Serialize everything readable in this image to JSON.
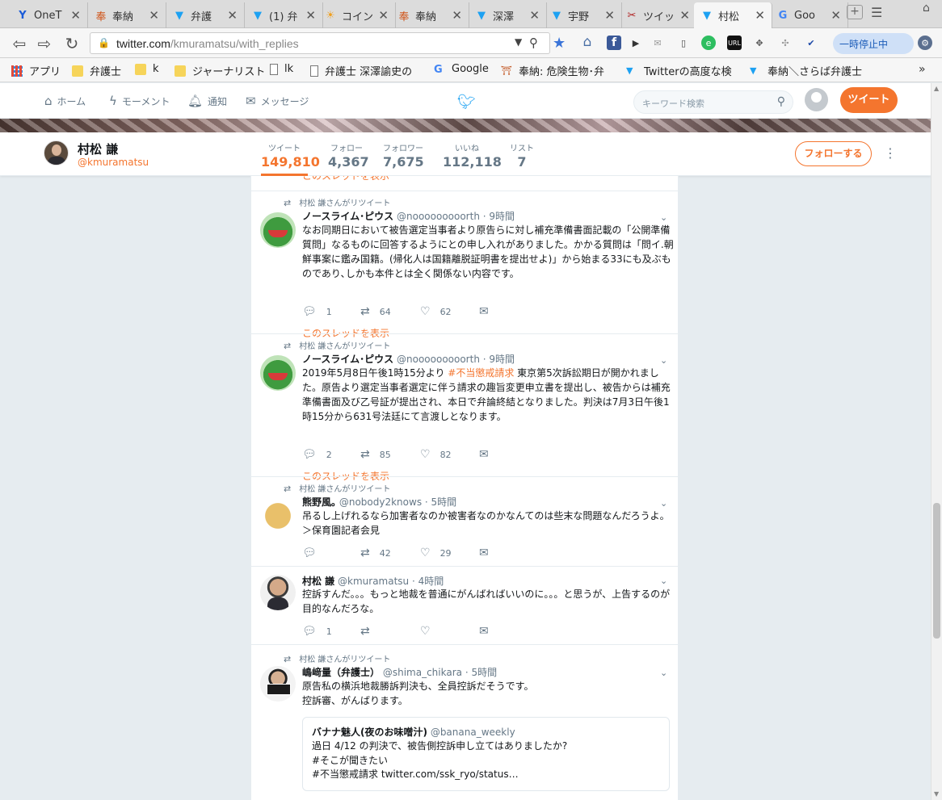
{
  "browser": {
    "tabs": [
      {
        "icon": "Y",
        "label": "OneT"
      },
      {
        "icon": "奉",
        "label": "奉納"
      },
      {
        "icon": "🐦",
        "label": "弁護"
      },
      {
        "icon": "🐦",
        "label": "(1) 弁"
      },
      {
        "icon": "☀",
        "label": "コイン"
      },
      {
        "icon": "奉",
        "label": "奉納"
      },
      {
        "icon": "🐦",
        "label": "深澤"
      },
      {
        "icon": "🐦",
        "label": "宇野"
      },
      {
        "icon": "✂",
        "label": "ツイッ"
      },
      {
        "icon": "🐦",
        "label": "村松"
      },
      {
        "icon": "G",
        "label": "Goo"
      }
    ],
    "url_host": "twitter.com",
    "url_path": "/kmuramatsu/with_replies",
    "pause_label": "一時停止中",
    "bookmarks": [
      "アプリ",
      "弁護士",
      "k",
      "ジャーナリスト",
      "lk",
      "弁護士 深澤諭史の",
      "Google",
      "奉納: 危険生物･弁",
      "Twitterの高度な検",
      "奉納＼さらば弁護士"
    ]
  },
  "twitter_nav": {
    "home": "ホーム",
    "moments": "モーメント",
    "notifications": "通知",
    "messages": "メッセージ",
    "search_placeholder": "キーワード検索",
    "tweet_button": "ツイート"
  },
  "profile": {
    "name": "村松 謙",
    "handle": "@kmuramatsu",
    "stats": [
      {
        "label": "ツイート",
        "value": "149,810"
      },
      {
        "label": "フォロー",
        "value": "4,367"
      },
      {
        "label": "フォロワー",
        "value": "7,675"
      },
      {
        "label": "いいね",
        "value": "112,118"
      },
      {
        "label": "リスト",
        "value": "7"
      }
    ],
    "follow_button": "フォローする"
  },
  "timeline": {
    "thread_link_top": "このスレッドを表示",
    "tweets": [
      {
        "retweet_by": "村松 謙さんがリツイート",
        "name": "ノースライム･ピウス",
        "handle": "@nooooooooorth",
        "time": "· 9時間",
        "text": "なお同期日において被告選定当事者より原告らに対し補充準備書面記載の「公開準備質問」なるものに回答するようにとの申し入れがありました。かかる質問は「問イ.朝鮮事案に鑑み国籍。(帰化人は国籍離脱証明書を提出せよ)」から始まる33にも及ぶものであり､しかも本件とは全く関係ない内容です。",
        "replies": "1",
        "retweets": "64",
        "likes": "62",
        "thread_link": "このスレッドを表示"
      },
      {
        "retweet_by": "村松 謙さんがリツイート",
        "name": "ノースライム･ピウス",
        "handle": "@nooooooooorth",
        "time": "· 9時間",
        "text_before": "2019年5月8日午後1時15分より ",
        "hashtag": "#不当懲戒請求",
        "text_after": " 東京第5次訴訟期日が開かれました。原告より選定当事者選定に伴う請求の趣旨変更申立書を提出し、被告からは補充準備書面及び乙号証が提出され、本日で弁論終結となりました。判決は7月3日午後1時15分から631号法廷にて言渡しとなります。",
        "replies": "2",
        "retweets": "85",
        "likes": "82",
        "thread_link": "このスレッドを表示"
      },
      {
        "retweet_by": "村松 謙さんがリツイート",
        "name": "熊野風｡",
        "handle": "@nobody2knows",
        "time": "· 5時間",
        "text": "吊るし上げれるなら加害者なのか被害者なのかなんてのは些末な問題なんだろうよ。＞保育園記者会見",
        "replies": "",
        "retweets": "42",
        "likes": "29"
      },
      {
        "name": "村松 謙",
        "handle": "@kmuramatsu",
        "time": "· 4時間",
        "text": "控訴すんだ。。。もっと地裁を普通にがんばればいいのに。。。と思うが、上告するのが目的なんだろな。",
        "replies": "1",
        "retweets": "",
        "likes": ""
      },
      {
        "retweet_by": "村松 謙さんがリツイート",
        "name": "嶋﨑量（弁護士）",
        "handle": "@shima_chikara",
        "time": "· 5時間",
        "text": "原告私の横浜地裁勝訴判決も、全員控訴だそうです。\n控訴審、がんばります。",
        "quote": {
          "name": "バナナ魅人(夜のお味噌汁)",
          "handle": "@banana_weekly",
          "line1": "過日 4/12 の判決で、被告側控訴申し立てはありましたか?",
          "line2": "#そこが聞きたい",
          "line3": "#不当懲戒請求 twitter.com/ssk_ryo/status…"
        }
      }
    ]
  }
}
